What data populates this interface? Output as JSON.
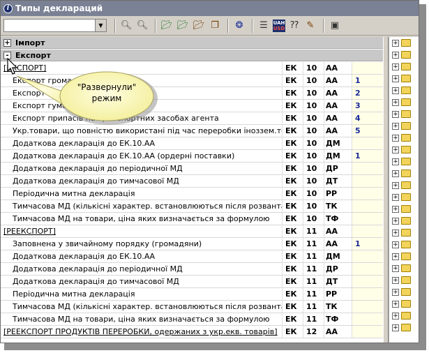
{
  "window": {
    "title": "Типы деклараций",
    "title_icon": "info-icon"
  },
  "toolbar": {
    "combo_value": "",
    "buttons": [
      {
        "name": "find-icon",
        "glyph": "⚲"
      },
      {
        "name": "find-next-icon",
        "glyph": "⚲"
      },
      {
        "name": "folder-add-icon",
        "glyph": "▰"
      },
      {
        "name": "folder-edit-icon",
        "glyph": "▰"
      },
      {
        "name": "folder-delete-icon",
        "glyph": "▰"
      },
      {
        "name": "copy-icon",
        "glyph": "❐"
      },
      {
        "name": "filter-icon",
        "glyph": "❂"
      },
      {
        "name": "tree-icon",
        "glyph": "☰"
      },
      {
        "name": "currency-icon",
        "line1": "UAH",
        "line2": "USD"
      },
      {
        "name": "help-icon",
        "glyph": "?"
      },
      {
        "name": "book-icon",
        "glyph": "✎"
      },
      {
        "name": "exit-icon",
        "glyph": "▣"
      }
    ]
  },
  "groups": {
    "import_label": "Імпорт",
    "import_btn": "+",
    "export_label": "Експорт",
    "export_btn": "-"
  },
  "callout": {
    "line1": "\"Развернули\"",
    "line2": "режим"
  },
  "rows": [
    {
      "name": "[ЕКСПОРТ]",
      "c1": "ЕК",
      "c2": "10",
      "c3": "АА",
      "c4": "",
      "section": true
    },
    {
      "name": "Експорт громадянами",
      "c1": "ЕК",
      "c2": "10",
      "c3": "АА",
      "c4": "1"
    },
    {
      "name": "Експорт (ордерні поставки)",
      "c1": "ЕК",
      "c2": "10",
      "c3": "АА",
      "c4": "2"
    },
    {
      "name": "Експорт гуманітарної допомоги",
      "c1": "ЕК",
      "c2": "10",
      "c3": "АА",
      "c4": "3"
    },
    {
      "name": "Експорт припасів на транспортних засобах агента",
      "c1": "ЕК",
      "c2": "10",
      "c3": "АА",
      "c4": "4"
    },
    {
      "name": "Укр.товари, що повністю використані під час переробки іноззем.товарів",
      "c1": "ЕК",
      "c2": "10",
      "c3": "АА",
      "c4": "5"
    },
    {
      "name": "Додаткова декларація до ЕК.10.АА",
      "c1": "ЕК",
      "c2": "10",
      "c3": "ДМ",
      "c4": ""
    },
    {
      "name": "Додаткова декларація до ЕК.10.АА (ордерні поставки)",
      "c1": "ЕК",
      "c2": "10",
      "c3": "ДМ",
      "c4": "1"
    },
    {
      "name": "Додаткова декларація до періодичної МД",
      "c1": "ЕК",
      "c2": "10",
      "c3": "ДР",
      "c4": ""
    },
    {
      "name": "Додаткова декларація до тимчасової МД",
      "c1": "ЕК",
      "c2": "10",
      "c3": "ДТ",
      "c4": ""
    },
    {
      "name": "Періодична митна декларація",
      "c1": "ЕК",
      "c2": "10",
      "c3": "РР",
      "c4": ""
    },
    {
      "name": "Тимчасова МД (кількісні характер. встановлюються після розвантаження)",
      "c1": "ЕК",
      "c2": "10",
      "c3": "ТК",
      "c4": ""
    },
    {
      "name": "Тимчасова МД на товари, ціна яких визначається за формулою",
      "c1": "ЕК",
      "c2": "10",
      "c3": "ТФ",
      "c4": ""
    },
    {
      "name": "[РЕЕКСПОРТ]",
      "c1": "ЕК",
      "c2": "11",
      "c3": "АА",
      "c4": "",
      "section": true
    },
    {
      "name": "Заповнена у звичайному порядку (громадяни)",
      "c1": "ЕК",
      "c2": "11",
      "c3": "АА",
      "c4": "1"
    },
    {
      "name": "Додаткова декларація до ЕК.10.АА",
      "c1": "ЕК",
      "c2": "11",
      "c3": "ДМ",
      "c4": ""
    },
    {
      "name": "Додаткова декларація до періодичної МД",
      "c1": "ЕК",
      "c2": "11",
      "c3": "ДР",
      "c4": ""
    },
    {
      "name": "Додаткова декларація до тимчасової МД",
      "c1": "ЕК",
      "c2": "11",
      "c3": "ДТ",
      "c4": ""
    },
    {
      "name": "Періодична митна декларація",
      "c1": "ЕК",
      "c2": "11",
      "c3": "РР",
      "c4": ""
    },
    {
      "name": "Тимчасова МД (кількісні характер. встановлюються після розвантаження)",
      "c1": "ЕК",
      "c2": "11",
      "c3": "ТК",
      "c4": ""
    },
    {
      "name": "Тимчасова МД на товари, ціна яких визначається за формулою",
      "c1": "ЕК",
      "c2": "11",
      "c3": "ТФ",
      "c4": ""
    },
    {
      "name": "[РЕЕКСПОРТ ПРОДУКТІВ ПЕРЕРОБКИ, одержаних з укр.екв. товарів]",
      "c1": "ЕК",
      "c2": "12",
      "c3": "АА",
      "c4": "",
      "section": true
    }
  ],
  "right_pane": {
    "expand_glyph": "+",
    "items_count_hint": ""
  }
}
